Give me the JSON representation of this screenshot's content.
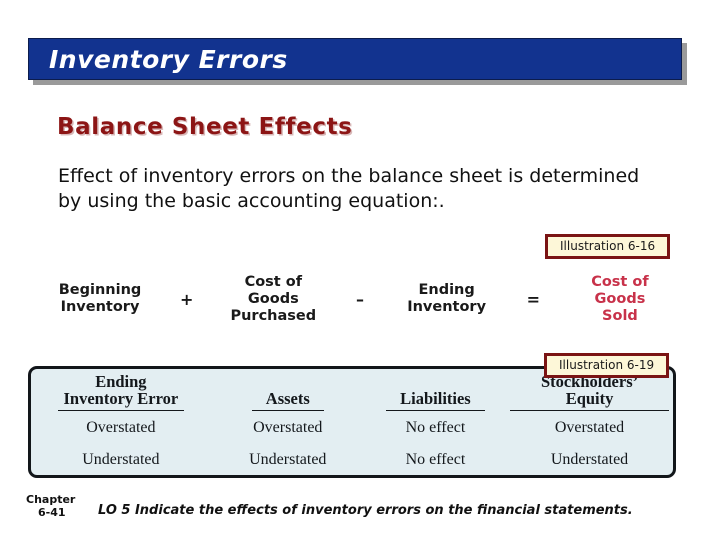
{
  "slide": {
    "title": "Inventory Errors",
    "section_heading": "Balance Sheet Effects",
    "body_text": "Effect of inventory errors on the balance sheet is determined by using the basic accounting equation:.",
    "colors": {
      "title_bar": "#12338f",
      "title_text": "#ffffff",
      "heading_red": "#8c1515",
      "accent_red": "#c8324a",
      "callout_bg": "#fdf7d8",
      "callout_border": "#7a1414",
      "table_bg": "#e3eef2",
      "table_border": "#12161a"
    }
  },
  "callouts": {
    "illustration_6_16": "Illustration 6-16",
    "illustration_6_19": "Illustration 6-19"
  },
  "equation": {
    "terms": [
      {
        "label": "Beginning\nInventory",
        "line1": "Beginning",
        "line2": "Inventory",
        "line3": "",
        "red": false
      },
      {
        "label": "+",
        "operator": true
      },
      {
        "label": "Cost of Goods Purchased",
        "line1": "Cost of",
        "line2": "Goods",
        "line3": "Purchased",
        "red": false
      },
      {
        "label": "–",
        "operator": true
      },
      {
        "label": "Ending Inventory",
        "line1": "Ending",
        "line2": "Inventory",
        "line3": "",
        "red": false
      },
      {
        "label": "=",
        "operator": true
      },
      {
        "label": "Cost of Goods Sold",
        "line1": "Cost of",
        "line2": "Goods",
        "line3": "Sold",
        "red": true
      }
    ],
    "op_plus": "+",
    "op_minus": "–",
    "op_equals": "="
  },
  "effects_table": {
    "headers": {
      "col1_line1": "Ending",
      "col1_line2": "Inventory Error",
      "col2": "Assets",
      "col3": "Liabilities",
      "col4": "Stockholders’ Equity"
    },
    "rows": [
      {
        "error": "Overstated",
        "assets": "Overstated",
        "liabilities": "No effect",
        "equity": "Overstated"
      },
      {
        "error": "Understated",
        "assets": "Understated",
        "liabilities": "No effect",
        "equity": "Understated"
      }
    ]
  },
  "footer": {
    "chapter_label": "Chapter",
    "chapter_number": "6-41",
    "learning_objective": "LO 5  Indicate the effects of inventory errors on the financial statements."
  }
}
